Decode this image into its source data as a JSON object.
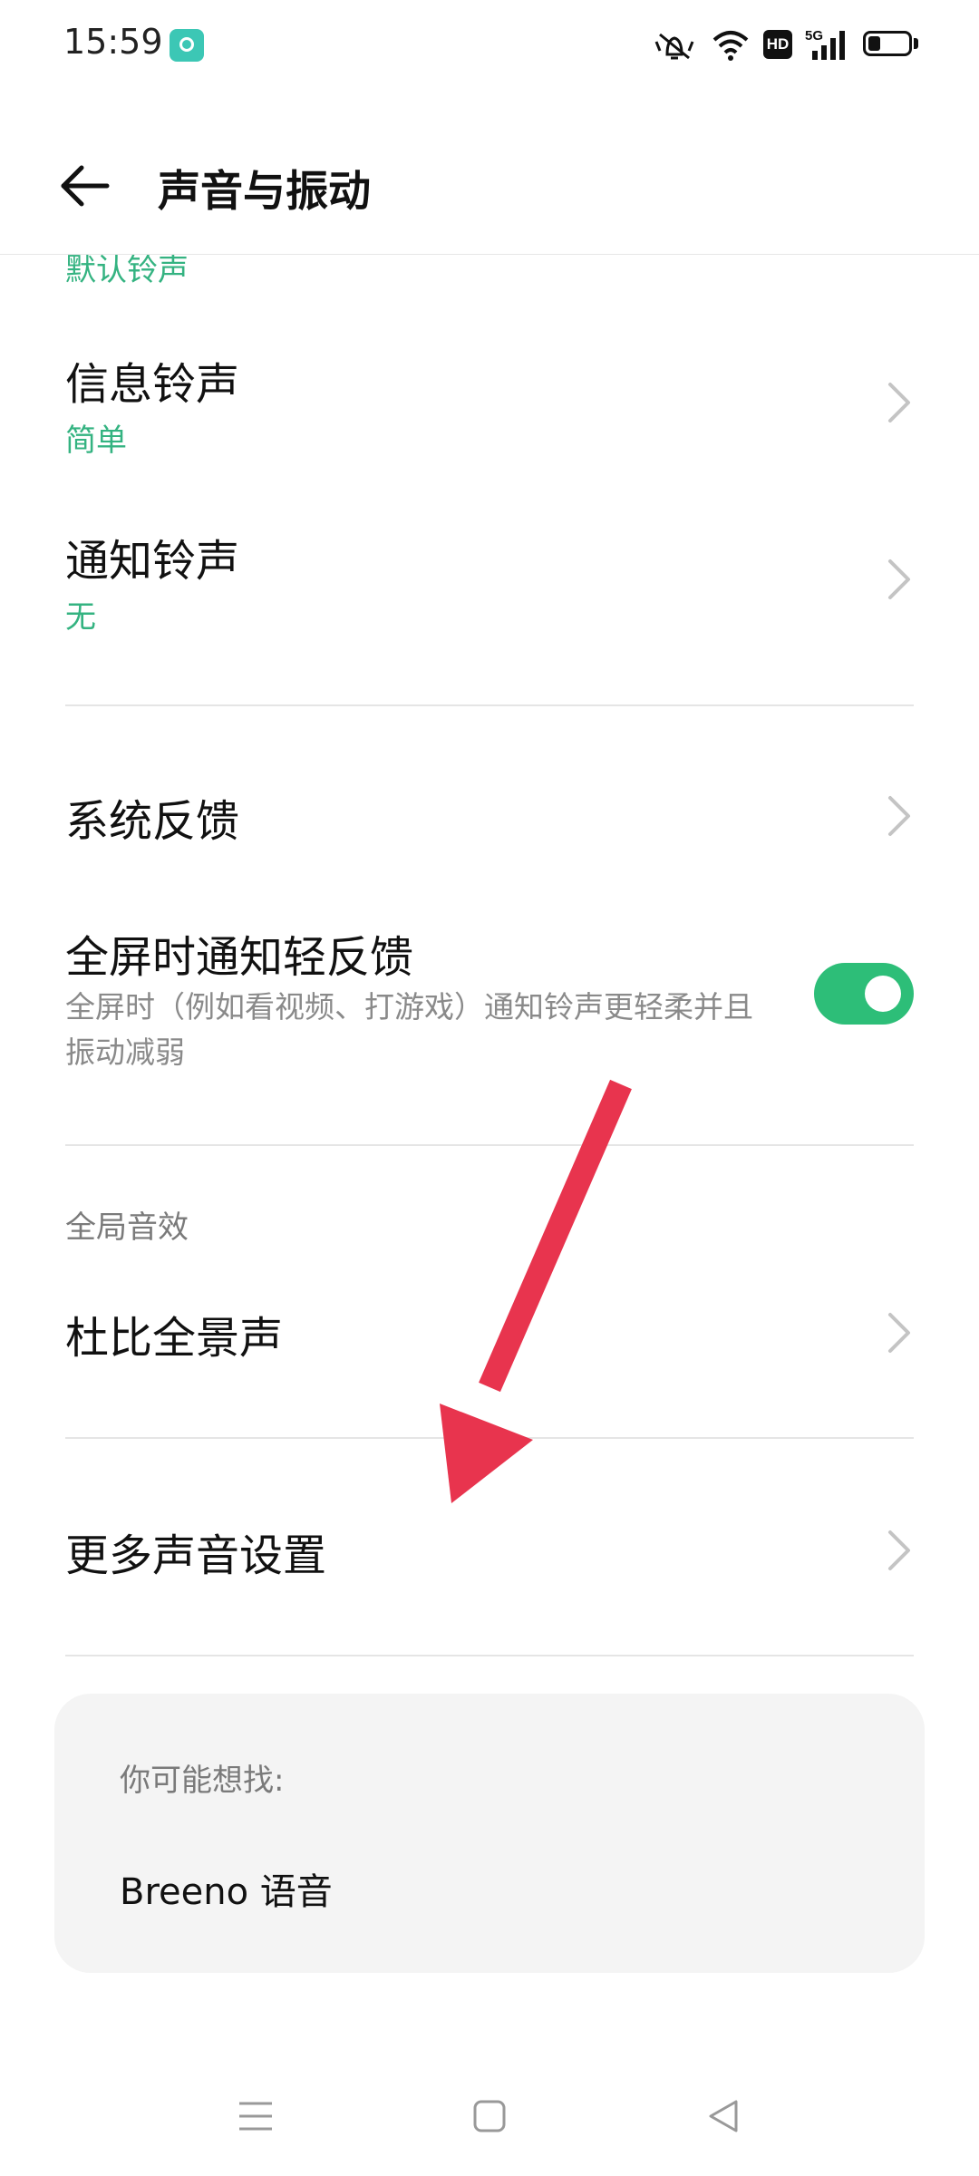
{
  "status_bar": {
    "time": "15:59",
    "network_badge": "HD",
    "network_type": "5G",
    "battery_level": 0.3,
    "icons": [
      "app-notification-icon",
      "mute-vibrate-icon",
      "wifi-icon",
      "hd-icon",
      "signal-icon",
      "battery-icon"
    ]
  },
  "header": {
    "title": "声音与振动",
    "back_icon": "back-arrow-icon"
  },
  "settings": {
    "clipped_value": "默认铃声",
    "message_ringtone": {
      "label": "信息铃声",
      "value": "简单"
    },
    "notification_ringtone": {
      "label": "通知铃声",
      "value": "无"
    },
    "system_feedback": {
      "label": "系统反馈"
    },
    "fullscreen_feedback": {
      "label": "全屏时通知轻反馈",
      "description": "全屏时（例如看视频、打游戏）通知铃声更轻柔并且振动减弱",
      "enabled": true
    },
    "global_effects_header": "全局音效",
    "dolby_atmos": {
      "label": "杜比全景声"
    },
    "more_sound_settings": {
      "label": "更多声音设置"
    }
  },
  "suggestions": {
    "heading": "你可能想找:",
    "items": [
      "Breeno 语音"
    ]
  },
  "colors": {
    "accent_green": "#34b381",
    "toggle_green": "#2dbe78",
    "annotation_arrow": "#e8344e"
  },
  "nav_bar": {
    "icons": [
      "menu-icon",
      "home-icon",
      "back-icon"
    ]
  }
}
